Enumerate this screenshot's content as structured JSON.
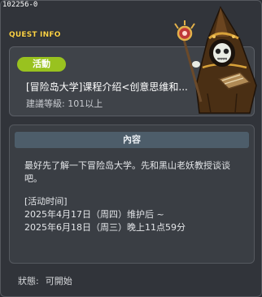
{
  "window": {
    "id_label": "102256-0",
    "title": "QUEST INFO"
  },
  "event": {
    "badge": "活動",
    "title": "[冒险岛大学]课程介绍<创意思维和...",
    "level_label": "建議等級:",
    "level_value": "101以上"
  },
  "content": {
    "header": "內容",
    "description": "最好先了解一下冒险岛大学。先和黑山老妖教授谈谈吧。",
    "period_heading": "[活动时间]",
    "period_start": "2025年4月17日（周四）维护后 ~",
    "period_end": "2025年6月18日（周三）晚上11点59分"
  },
  "status": {
    "label": "狀態:",
    "value": "可開始"
  },
  "colors": {
    "badge_green": "#99c21f",
    "title_yellow": "#ffd54a",
    "content_header_bg": "#4d5d6a"
  },
  "character": {
    "icon": "hooded-lich-professor-npc"
  }
}
